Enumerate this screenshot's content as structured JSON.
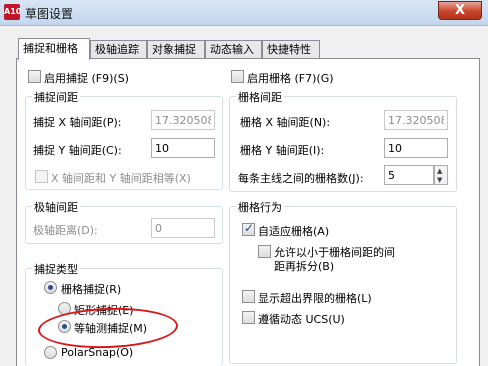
{
  "window": {
    "title": "草图设置",
    "logo_text": "A10",
    "close_label": "X"
  },
  "tabs": [
    {
      "label": "捕捉和栅格",
      "active": true
    },
    {
      "label": "极轴追踪",
      "active": false
    },
    {
      "label": "对象捕捉",
      "active": false
    },
    {
      "label": "动态输入",
      "active": false
    },
    {
      "label": "快捷特性",
      "active": false
    }
  ],
  "snap": {
    "enable_label": "启用捕捉 (F9)(S)",
    "enabled": false,
    "spacing_title": "捕捉间距",
    "x_label": "捕捉 X 轴间距(P):",
    "x_value": "17.3205080",
    "y_label": "捕捉 Y 轴间距(C):",
    "y_value": "10",
    "equal_label": "X 轴间距和 Y 轴间距相等(X)",
    "equal_checked": false
  },
  "polar": {
    "title": "极轴间距",
    "distance_label": "极轴距离(D):",
    "distance_value": "0"
  },
  "snap_type": {
    "title": "捕捉类型",
    "grid_snap_label": "栅格捕捉(R)",
    "rect_snap_label": "矩形捕捉(E)",
    "iso_snap_label": "等轴测捕捉(M)",
    "polar_snap_label": "PolarSnap(O)"
  },
  "grid": {
    "enable_label": "启用栅格 (F7)(G)",
    "enabled": false,
    "spacing_title": "栅格间距",
    "x_label": "栅格 X 轴间距(N):",
    "x_value": "17.3205080",
    "y_label": "栅格 Y 轴间距(I):",
    "y_value": "10",
    "major_label": "每条主线之间的栅格数(J):",
    "major_value": "5"
  },
  "grid_behavior": {
    "title": "栅格行为",
    "adaptive_label": "自适应栅格(A)",
    "adaptive_checked": true,
    "subdivide_label_1": "允许以小于栅格间距的间",
    "subdivide_label_2": "距再拆分(B)",
    "subdivide_checked": false,
    "beyond_limits_label": "显示超出界限的栅格(L)",
    "beyond_limits_checked": false,
    "follow_ucs_label": "遵循动态 UCS(U)",
    "follow_ucs_checked": false
  },
  "colors": {
    "annotation_red": "#d81818",
    "radio_dot": "#2c4f87"
  }
}
